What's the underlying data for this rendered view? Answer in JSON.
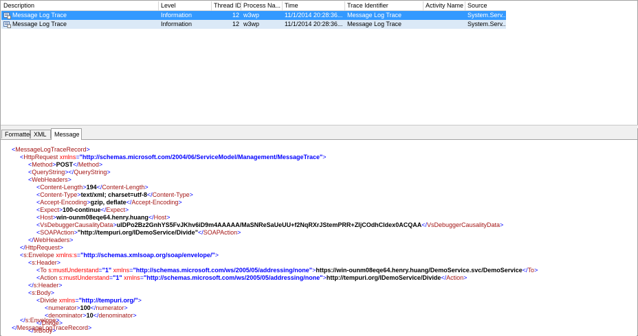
{
  "grid": {
    "columns": [
      "Description",
      "Level",
      "Thread ID",
      "Process Na...",
      "Time",
      "Trace Identifier",
      "Activity Name",
      "Source"
    ],
    "rows": [
      {
        "description": "Message Log Trace",
        "level": "Information",
        "thread_id": "12",
        "process": "w3wp",
        "time": "11/1/2014 20:28:36...",
        "trace_identifier": "Message Log Trace",
        "activity": "",
        "source": "System.Serv...",
        "icon": "message-log-icon"
      },
      {
        "description": "Message Log Trace",
        "level": "Information",
        "thread_id": "12",
        "process": "w3wp",
        "time": "11/1/2014 20:28:36...",
        "trace_identifier": "Message Log Trace",
        "activity": "",
        "source": "System.Serv...",
        "icon": "message-log-icon"
      }
    ],
    "selected_color": "#3399ff",
    "alt_color": "#dbe9f7"
  },
  "tabs": [
    "Formatted",
    "XML",
    "Message"
  ],
  "active_tab": "Message",
  "xml": {
    "root_open": "MessageLogTraceRecord",
    "httprequest_tag": "HttpRequest",
    "httprequest_ns_attr": "xmlns",
    "httprequest_ns": "\"http://schemas.microsoft.com/2004/06/ServiceModel/Management/MessageTrace\"",
    "method_tag": "Method",
    "method_value": "POST",
    "querystring_tag": "QueryString",
    "webheaders_tag": "WebHeaders",
    "content_length_tag": "Content-Length",
    "content_length": "194",
    "content_type_tag": "Content-Type",
    "content_type": "text/xml; charset=utf-8",
    "accept_encoding_tag": "Accept-Encoding",
    "accept_encoding": "gzip, deflate",
    "expect_tag": "Expect",
    "expect": "100-continue",
    "host_tag": "Host",
    "host": "win-ounm08eqe64.henry.huang",
    "vsdebug_tag": "VsDebuggerCausalityData",
    "vsdebug": "uIDPo2Bz2GnhYS5FvJKhv6iD9m4AAAAA/MaSNReSaUeUU+f2NqRXrJStemPRR+ZIjCOdhCldex0ACQAA",
    "soapaction_tag": "SOAPAction",
    "soapaction": "\"http://tempuri.org/IDemoService/Divide\"",
    "envelope_tag": "s:Envelope",
    "envelope_ns_attr": "xmlns:s",
    "envelope_ns": "\"http://schemas.xmlsoap.org/soap/envelope/\"",
    "header_tag": "s:Header",
    "to_tag": "To",
    "mu_attr": "s:mustUnderstand",
    "mu_val": "\"1\"",
    "xmlns_attr": "xmlns",
    "addressing_ns": "\"http://schemas.microsoft.com/ws/2005/05/addressing/none\"",
    "to_value": "https://win-ounm08eqe64.henry.huang/DemoService.svc/DemoService",
    "action_tag": "Action",
    "action_value": "http://tempuri.org/IDemoService/Divide",
    "body_tag": "s:Body",
    "divide_tag": "Divide",
    "divide_ns": "\"http://tempuri.org/\"",
    "numerator_tag": "numerator",
    "numerator": "100",
    "denominator_tag": "denominator",
    "denominator": "10"
  }
}
